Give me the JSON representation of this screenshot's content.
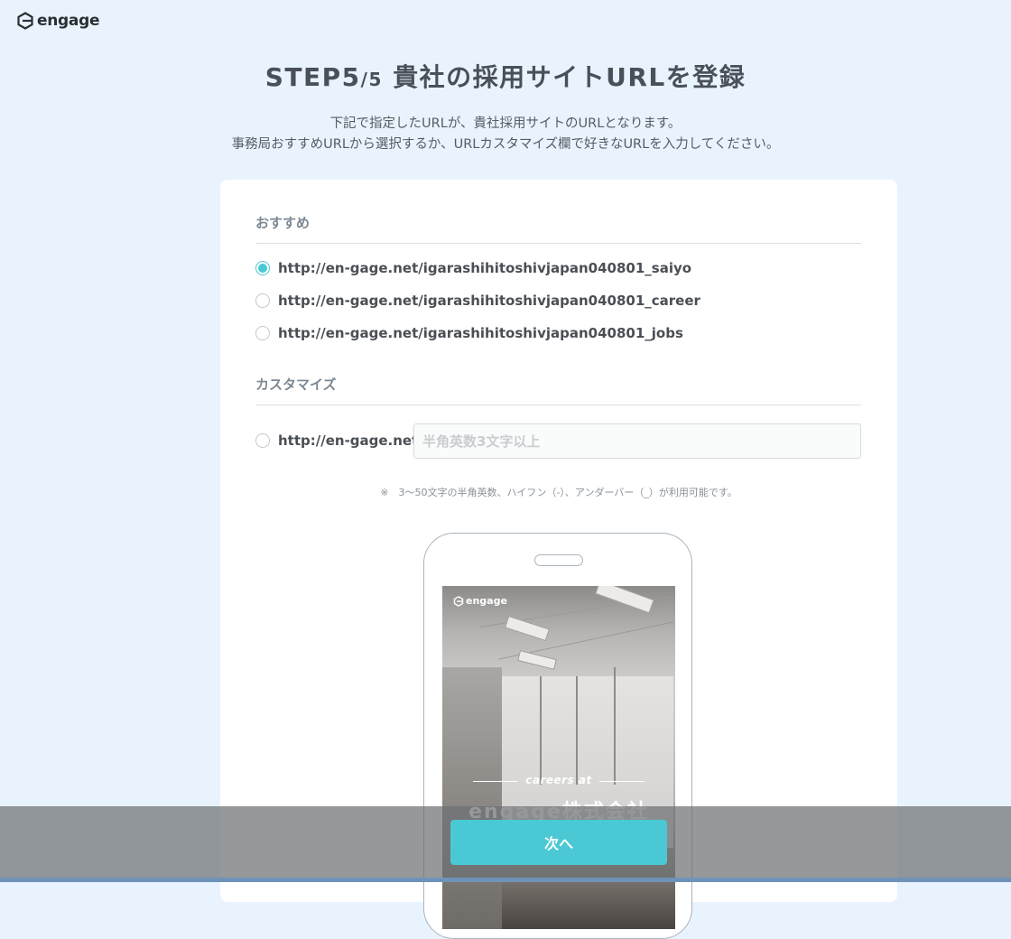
{
  "header": {
    "logo_text": "engage"
  },
  "title": {
    "step": "STEP5",
    "step_total": "/5",
    "main": " 貴社の採用サイトURLを登録"
  },
  "subtitle": {
    "line1": "下記で指定したURLが、貴社採用サイトのURLとなります。",
    "line2": "事務局おすすめURLから選択するか、URLカスタマイズ欄で好きなURLを入力してください。"
  },
  "recommended": {
    "heading": "おすすめ",
    "options": [
      {
        "label": "http://en-gage.net/igarashihitoshivjapan040801_saiyo",
        "selected": true
      },
      {
        "label": "http://en-gage.net/igarashihitoshivjapan040801_career",
        "selected": false
      },
      {
        "label": "http://en-gage.net/igarashihitoshivjapan040801_jobs",
        "selected": false
      }
    ]
  },
  "customize": {
    "heading": "カスタマイズ",
    "prefix": "http://en-gage.net/",
    "input_value": "",
    "input_placeholder": "半角英数3文字以上",
    "note": "※　3〜50文字の半角英数、ハイフン（-）、アンダーバー（_）が利用可能です。"
  },
  "preview": {
    "logo_text": "engage",
    "careers_text": "careers at",
    "company_text": "engage株式会社"
  },
  "footer": {
    "next_label": "次へ"
  },
  "colors": {
    "accent": "#4ac9d4",
    "background": "#e8f3fd",
    "card": "#ffffff"
  }
}
